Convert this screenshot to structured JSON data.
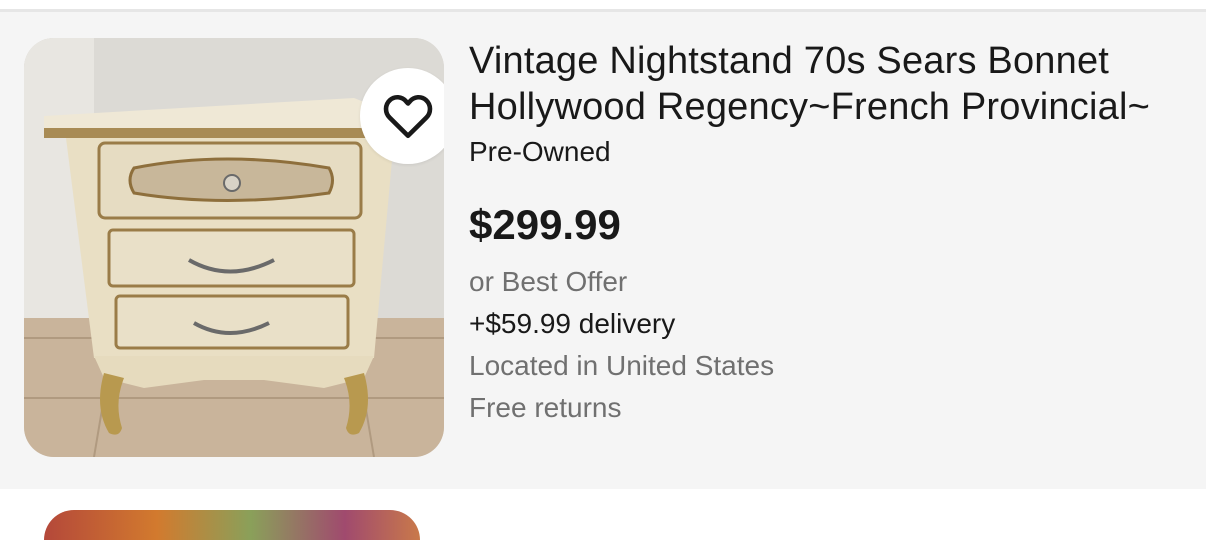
{
  "listing": {
    "title": "Vintage Nightstand 70s Sears Bonnet Hollywood Regency~French Provincial~",
    "condition": "Pre-Owned",
    "price": "$299.99",
    "best_offer": "or Best Offer",
    "delivery": "+$59.99 delivery",
    "location": "Located in United States",
    "returns": "Free returns",
    "image_alt": "Vintage nightstand photo",
    "wishlist_icon": "heart-icon"
  },
  "colors": {
    "card_background": "#f5f5f5",
    "text_primary": "#191919",
    "text_secondary": "#707070"
  }
}
